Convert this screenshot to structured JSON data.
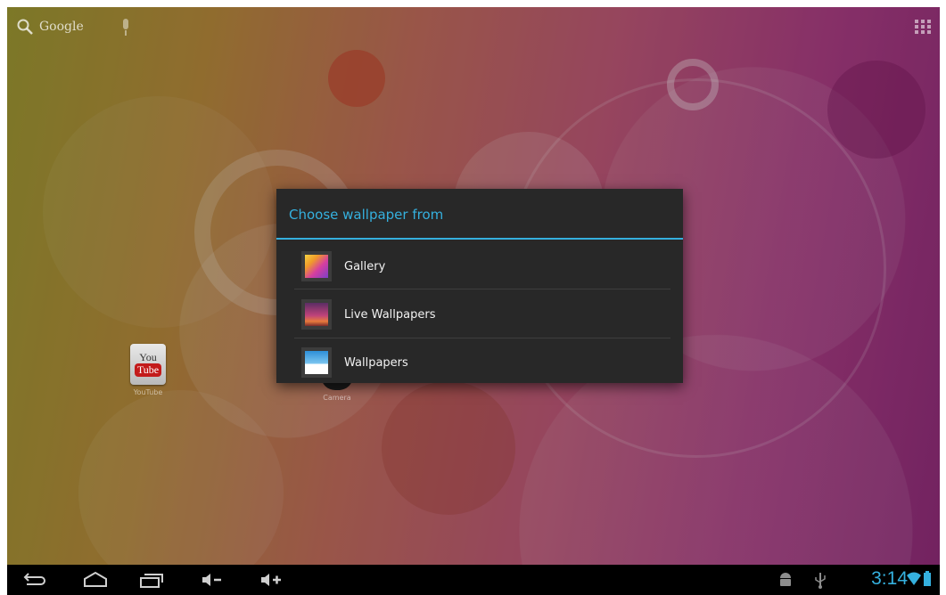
{
  "topbar": {
    "search_label": "Google"
  },
  "desktop": {
    "apps": [
      {
        "label": "YouTube",
        "icon": "youtube-icon"
      },
      {
        "label": "Camera",
        "icon": "camera-icon"
      }
    ]
  },
  "dialog": {
    "title": "Choose wallpaper from",
    "options": [
      {
        "label": "Gallery",
        "icon": "gallery-icon"
      },
      {
        "label": "Live Wallpapers",
        "icon": "live-wallpapers-icon"
      },
      {
        "label": "Wallpapers",
        "icon": "wallpapers-icon"
      }
    ]
  },
  "youtube_icon_text": {
    "top": "You",
    "bottom": "Tube"
  },
  "statusbar": {
    "time": "3:14"
  },
  "colors": {
    "accent": "#35b0de",
    "dialog_bg": "#282828",
    "navbar_bg": "#000000"
  }
}
